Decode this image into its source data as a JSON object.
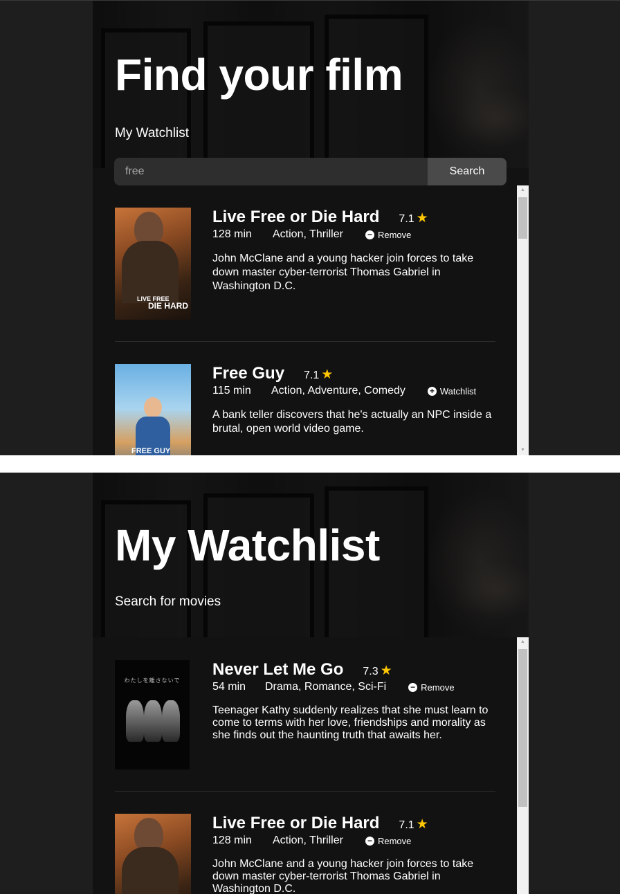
{
  "screens": [
    {
      "hero_title": "Find your film",
      "nav_link": "My Watchlist",
      "search": {
        "value": "free",
        "button_label": "Search"
      },
      "movies": [
        {
          "title": "Live Free or Die Hard",
          "rating": "7.1",
          "runtime": "128 min",
          "genre": "Action, Thriller",
          "action_label": "Remove",
          "action_icon": "minus-circle-icon",
          "plot": "John McClane and a young hacker join forces to take down master cyber-terrorist Thomas Gabriel in Washington D.C.",
          "poster_text": "LIVE FREE",
          "poster_text2": "DIE HARD"
        },
        {
          "title": "Free Guy",
          "rating": "7.1",
          "runtime": "115 min",
          "genre": "Action, Adventure, Comedy",
          "action_label": "Watchlist",
          "action_icon": "plus-circle-icon",
          "plot": "A bank teller discovers that he's actually an NPC inside a brutal, open world video game.",
          "poster_text": "FREE GUY"
        }
      ]
    },
    {
      "hero_title": "My Watchlist",
      "nav_link": "Search for movies",
      "movies": [
        {
          "title": "Never Let Me Go",
          "rating": "7.3",
          "runtime": "54 min",
          "genre": "Drama, Romance, Sci-Fi",
          "action_label": "Remove",
          "action_icon": "minus-circle-icon",
          "plot": "Teenager Kathy suddenly realizes that she must learn to come to terms with her love, friendships and morality as she finds out the haunting truth that awaits her.",
          "poster_text": "わたしを離さないで"
        },
        {
          "title": "Live Free or Die Hard",
          "rating": "7.1",
          "runtime": "128 min",
          "genre": "Action, Thriller",
          "action_label": "Remove",
          "action_icon": "minus-circle-icon",
          "plot": "John McClane and a young hacker join forces to take down master cyber-terrorist Thomas Gabriel in Washington D.C."
        }
      ]
    }
  ],
  "colors": {
    "background": "#1e1e1e",
    "app_bg": "#121212",
    "star": "#fec701",
    "button": "#4a4a4a",
    "input": "#2e2e2e"
  },
  "icons": {
    "rating": "star-icon"
  }
}
